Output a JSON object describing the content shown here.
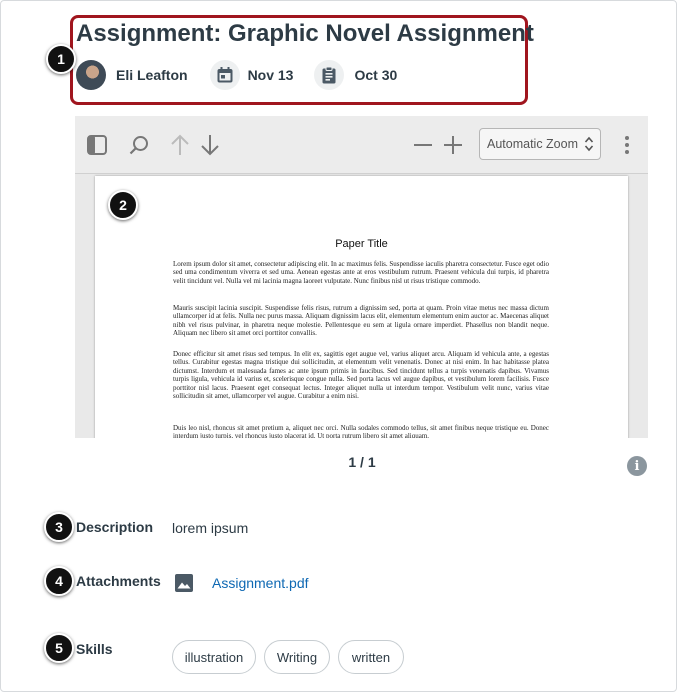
{
  "header": {
    "title": "Assignment: Graphic Novel Assignment",
    "author": "Eli Leafton",
    "due_date": "Nov 13",
    "submitted_date": "Oct 30"
  },
  "viewer": {
    "zoom": "Automatic Zoom",
    "page_indicator": "1 / 1",
    "document": {
      "title": "Paper Title",
      "paragraphs": [
        "Lorem ipsum dolor sit amet, consectetur adipiscing elit. In ac maximus felis. Suspendisse iaculis pharetra consectetur. Fusce eget odio sed uma condimentum viverra et sed uma. Aenean egestas ante at eros vestibulum rutrum. Praesent vehicula dui turpis, id pharetra velit tincidunt vel. Nulla vel mi lacinia magna laoreet vulputate. Nunc finibus nisl ut risus tristique commodo.",
        "Mauris suscipit lacinia suscipit. Suspendisse felis risus, rutrum a dignissim sed, porta at quam. Proin vitae metus nec massa dictum ullamcorper id at felis. Nulla nec purus massa. Aliquam dignissim lacus elit, elementum elementum enim auctor ac. Maecenas aliquet nibh vel risus pulvinar, in pharetra neque molestie. Pellentesque eu sem at ligula ornare imperdiet. Phasellus non blandit neque. Aliquam nec libero sit amet orci porttitor convallis.",
        "Donec efficitur sit amet risus sed tempus. In elit ex, sagittis eget augue vel, varius aliquet arcu. Aliquam id vehicula ante, a egestas tellus. Curabitur egestas magna tristique dui sollicitudin, at elementum velit venenatis. Donec at nisi enim. In hac habitasse platea dictumst. Interdum et malesuada fames ac ante ipsum primis in faucibus. Sed tincidunt tellus a turpis venenatis dapibus. Vivamus turpis ligula, vehicula id varius et, scelerisque congue nulla. Sed porta lacus vel augue dapibus, et vestibulum lorem facilisis. Fusce porttitor nisl lacus. Praesent eget consequat lectus. Integer aliquet nulla ut interdum tempor. Vestibulum velit nunc, varius vitae sollicitudin sit amet, ullamcorper vel augue. Curabitur a enim nisi.",
        "Duis leo nisl, rhoncus sit amet pretium a, aliquet nec orci. Nulla sodales commodo tellus, sit amet finibus neque tristique eu. Donec interdum justo turpis, vel rhoncus justo placerat id. Ut porta rutrum libero sit amet aliquam."
      ]
    }
  },
  "details": {
    "description_label": "Description",
    "description_value": "lorem ipsum",
    "attachments_label": "Attachments",
    "attachment_file": "Assignment.pdf",
    "skills_label": "Skills",
    "skills": [
      "illustration",
      "Writing",
      "written"
    ]
  },
  "callouts": [
    "1",
    "2",
    "3",
    "4",
    "5"
  ],
  "icons": {
    "due": "calendar-icon",
    "submitted": "clipboard-icon",
    "attachment": "image-file-icon",
    "info": "info-icon"
  },
  "colors": {
    "highlight_border": "#a0151e",
    "link": "#0e68b3",
    "text": "#2d3b45"
  }
}
